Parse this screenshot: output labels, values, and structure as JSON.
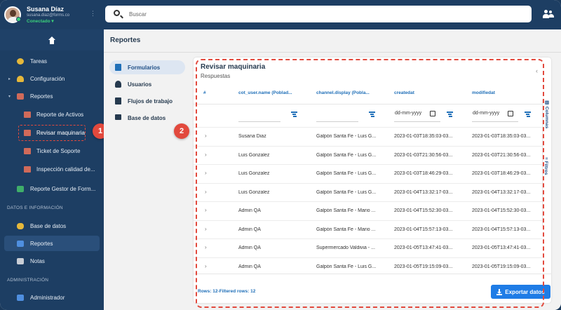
{
  "user": {
    "name": "Susana Díaz",
    "email": "susana.diaz@forms.co",
    "status": "Conectado"
  },
  "sidebar": {
    "items": [
      {
        "label": "Tareas"
      },
      {
        "label": "Configuración"
      },
      {
        "label": "Reportes"
      },
      {
        "label": "Reporte de Activos"
      },
      {
        "label": "Revisar maquinaria"
      },
      {
        "label": "Ticket de Soporte"
      },
      {
        "label": "Inspección calidad de..."
      },
      {
        "label": "Reporte Gestor de Form..."
      }
    ],
    "section_data": "DATOS E INFORMACIÓN",
    "data_items": [
      {
        "label": "Base de datos"
      },
      {
        "label": "Reportes"
      },
      {
        "label": "Notas"
      }
    ],
    "section_admin": "ADMINISTRACIÓN",
    "admin_items": [
      {
        "label": "Administrador"
      }
    ]
  },
  "search": {
    "placeholder": "Buscar"
  },
  "page": {
    "title": "Reportes"
  },
  "menu": [
    {
      "label": "Formularios"
    },
    {
      "label": "Usuarios"
    },
    {
      "label": "Flujos de trabajo"
    },
    {
      "label": "Base de datos"
    }
  ],
  "card": {
    "title": "Revisar maquinaria",
    "subtitle": "Respuestas"
  },
  "table": {
    "columns": [
      "#",
      "cot_user.name (Poblad...",
      "channel.display (Pobla...",
      "createdat",
      "modifiedat"
    ],
    "date_placeholder": "dd-mm-yyyy",
    "rows": [
      [
        "Susana Diaz",
        "Galpón Santa Fe - Luis G...",
        "2023-01-03T18:35:03-03...",
        "2023-01-03T18:35:03-03..."
      ],
      [
        "Luis Gonzalez",
        "Galpón Santa Fe - Luis G...",
        "2023-01-03T21:30:56-03...",
        "2023-01-03T21:30:56-03..."
      ],
      [
        "Luis Gonzalez",
        "Galpón Santa Fe - Luis G...",
        "2023-01-03T18:46:29-03...",
        "2023-01-03T18:46:29-03..."
      ],
      [
        "Luis Gonzalez",
        "Galpón Santa Fe - Luis G...",
        "2023-01-04T13:32:17-03...",
        "2023-01-04T13:32:17-03..."
      ],
      [
        "Admin QA",
        "Galpón Santa Fe - Mario ...",
        "2023-01-04T15:52:30-03...",
        "2023-01-04T15:52:30-03..."
      ],
      [
        "Admin QA",
        "Galpón Santa Fe - Mario ...",
        "2023-01-04T15:57:13-03...",
        "2023-01-04T15:57:13-03..."
      ],
      [
        "Admin QA",
        "Supermercado Valdivia - ...",
        "2023-01-05T13:47:41-03...",
        "2023-01-05T13:47:41-03..."
      ],
      [
        "Admin QA",
        "Galpón Santa Fe - Luis G...",
        "2023-01-05T19:15:09-03...",
        "2023-01-05T19:15:09-03..."
      ]
    ]
  },
  "side_tabs": {
    "columns": "Columnas",
    "filters": "Filtros"
  },
  "footer": {
    "rows_info": "Rows: 12-Filtered rows: 12",
    "export_label": "Exportar datos"
  },
  "callouts": {
    "one": "1",
    "two": "2"
  },
  "colors": {
    "sidebar": "#1d3e63",
    "accent": "#1f7ce6",
    "callout": "#e2493d"
  }
}
